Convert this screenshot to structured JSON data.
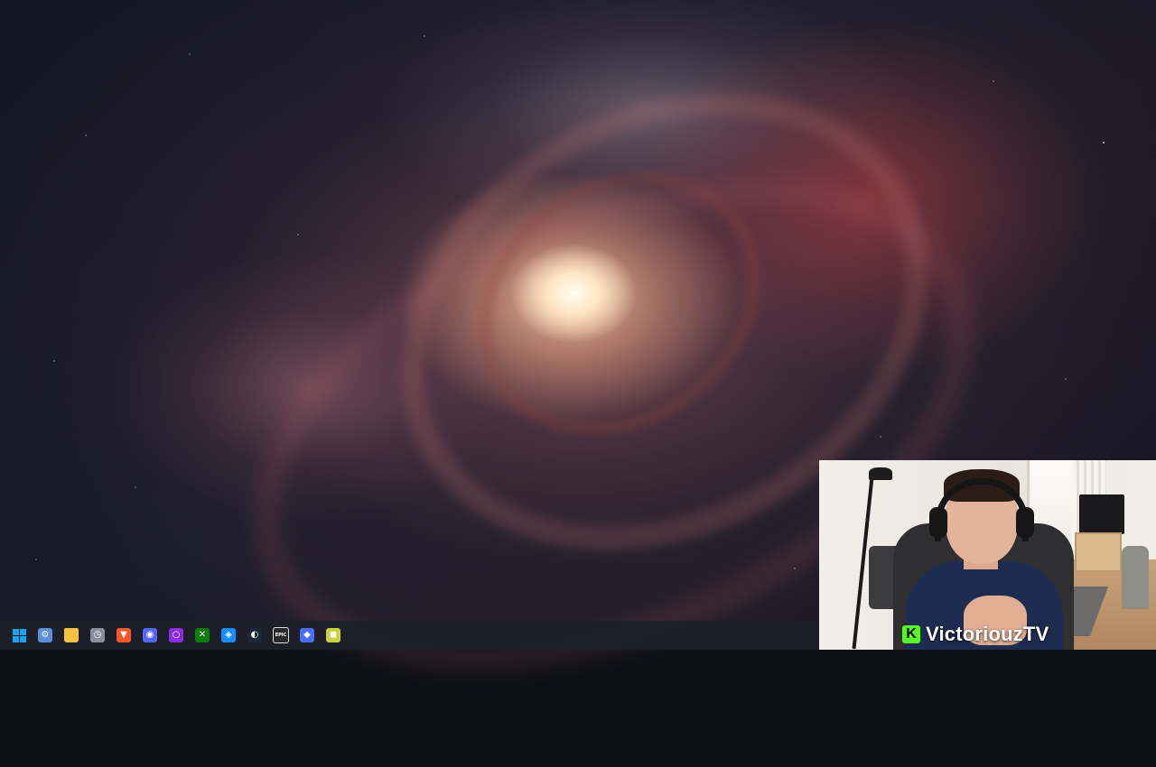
{
  "desktop": {
    "wallpaper": "galaxy"
  },
  "taskbar": {
    "items": [
      {
        "name": "windows-start-icon",
        "glyph": "",
        "color": "#1aa3f0"
      },
      {
        "name": "settings-icon",
        "glyph": "⚙",
        "color": "#5b8fd6"
      },
      {
        "name": "file-explorer-icon",
        "glyph": "",
        "color": "#f5c242"
      },
      {
        "name": "clock-icon",
        "glyph": "◷",
        "color": "#8a8f9c"
      },
      {
        "name": "brave-browser-icon",
        "glyph": "▼",
        "color": "#fb542b"
      },
      {
        "name": "discord-icon",
        "glyph": "◉",
        "color": "#5865f2"
      },
      {
        "name": "app-circle-icon",
        "glyph": "○",
        "color": "#8b2be2"
      },
      {
        "name": "xbox-icon",
        "glyph": "✕",
        "color": "#107c10"
      },
      {
        "name": "battlenet-icon",
        "glyph": "◈",
        "color": "#148eff"
      },
      {
        "name": "steam-icon",
        "glyph": "◐",
        "color": "#1b2838"
      },
      {
        "name": "epic-games-icon",
        "glyph": "EPIC",
        "color": "#2a2a2a"
      },
      {
        "name": "roblox-icon",
        "glyph": "◆",
        "color": "#4a6cf7"
      },
      {
        "name": "bluestacks-icon",
        "glyph": "◼",
        "color": "#c8d23a"
      }
    ]
  },
  "webcam": {
    "brand_letter": "K",
    "brand_color": "#53fc18",
    "channel_name": "VictoriouzTV"
  }
}
